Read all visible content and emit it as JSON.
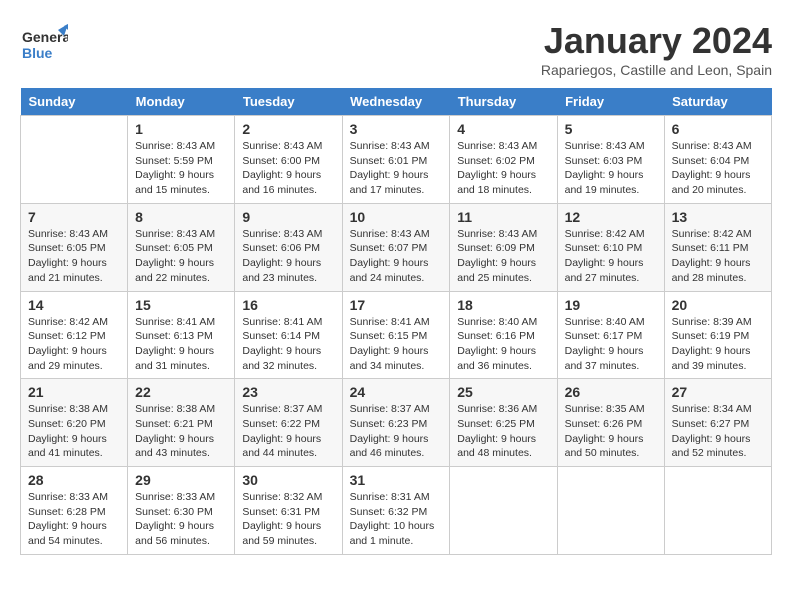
{
  "header": {
    "logo_general": "General",
    "logo_blue": "Blue",
    "month": "January 2024",
    "location": "Rapariegos, Castille and Leon, Spain"
  },
  "days_of_week": [
    "Sunday",
    "Monday",
    "Tuesday",
    "Wednesday",
    "Thursday",
    "Friday",
    "Saturday"
  ],
  "weeks": [
    [
      {
        "day": "",
        "info": ""
      },
      {
        "day": "1",
        "info": "Sunrise: 8:43 AM\nSunset: 5:59 PM\nDaylight: 9 hours\nand 15 minutes."
      },
      {
        "day": "2",
        "info": "Sunrise: 8:43 AM\nSunset: 6:00 PM\nDaylight: 9 hours\nand 16 minutes."
      },
      {
        "day": "3",
        "info": "Sunrise: 8:43 AM\nSunset: 6:01 PM\nDaylight: 9 hours\nand 17 minutes."
      },
      {
        "day": "4",
        "info": "Sunrise: 8:43 AM\nSunset: 6:02 PM\nDaylight: 9 hours\nand 18 minutes."
      },
      {
        "day": "5",
        "info": "Sunrise: 8:43 AM\nSunset: 6:03 PM\nDaylight: 9 hours\nand 19 minutes."
      },
      {
        "day": "6",
        "info": "Sunrise: 8:43 AM\nSunset: 6:04 PM\nDaylight: 9 hours\nand 20 minutes."
      }
    ],
    [
      {
        "day": "7",
        "info": "Sunrise: 8:43 AM\nSunset: 6:05 PM\nDaylight: 9 hours\nand 21 minutes."
      },
      {
        "day": "8",
        "info": "Sunrise: 8:43 AM\nSunset: 6:05 PM\nDaylight: 9 hours\nand 22 minutes."
      },
      {
        "day": "9",
        "info": "Sunrise: 8:43 AM\nSunset: 6:06 PM\nDaylight: 9 hours\nand 23 minutes."
      },
      {
        "day": "10",
        "info": "Sunrise: 8:43 AM\nSunset: 6:07 PM\nDaylight: 9 hours\nand 24 minutes."
      },
      {
        "day": "11",
        "info": "Sunrise: 8:43 AM\nSunset: 6:09 PM\nDaylight: 9 hours\nand 25 minutes."
      },
      {
        "day": "12",
        "info": "Sunrise: 8:42 AM\nSunset: 6:10 PM\nDaylight: 9 hours\nand 27 minutes."
      },
      {
        "day": "13",
        "info": "Sunrise: 8:42 AM\nSunset: 6:11 PM\nDaylight: 9 hours\nand 28 minutes."
      }
    ],
    [
      {
        "day": "14",
        "info": "Sunrise: 8:42 AM\nSunset: 6:12 PM\nDaylight: 9 hours\nand 29 minutes."
      },
      {
        "day": "15",
        "info": "Sunrise: 8:41 AM\nSunset: 6:13 PM\nDaylight: 9 hours\nand 31 minutes."
      },
      {
        "day": "16",
        "info": "Sunrise: 8:41 AM\nSunset: 6:14 PM\nDaylight: 9 hours\nand 32 minutes."
      },
      {
        "day": "17",
        "info": "Sunrise: 8:41 AM\nSunset: 6:15 PM\nDaylight: 9 hours\nand 34 minutes."
      },
      {
        "day": "18",
        "info": "Sunrise: 8:40 AM\nSunset: 6:16 PM\nDaylight: 9 hours\nand 36 minutes."
      },
      {
        "day": "19",
        "info": "Sunrise: 8:40 AM\nSunset: 6:17 PM\nDaylight: 9 hours\nand 37 minutes."
      },
      {
        "day": "20",
        "info": "Sunrise: 8:39 AM\nSunset: 6:19 PM\nDaylight: 9 hours\nand 39 minutes."
      }
    ],
    [
      {
        "day": "21",
        "info": "Sunrise: 8:38 AM\nSunset: 6:20 PM\nDaylight: 9 hours\nand 41 minutes."
      },
      {
        "day": "22",
        "info": "Sunrise: 8:38 AM\nSunset: 6:21 PM\nDaylight: 9 hours\nand 43 minutes."
      },
      {
        "day": "23",
        "info": "Sunrise: 8:37 AM\nSunset: 6:22 PM\nDaylight: 9 hours\nand 44 minutes."
      },
      {
        "day": "24",
        "info": "Sunrise: 8:37 AM\nSunset: 6:23 PM\nDaylight: 9 hours\nand 46 minutes."
      },
      {
        "day": "25",
        "info": "Sunrise: 8:36 AM\nSunset: 6:25 PM\nDaylight: 9 hours\nand 48 minutes."
      },
      {
        "day": "26",
        "info": "Sunrise: 8:35 AM\nSunset: 6:26 PM\nDaylight: 9 hours\nand 50 minutes."
      },
      {
        "day": "27",
        "info": "Sunrise: 8:34 AM\nSunset: 6:27 PM\nDaylight: 9 hours\nand 52 minutes."
      }
    ],
    [
      {
        "day": "28",
        "info": "Sunrise: 8:33 AM\nSunset: 6:28 PM\nDaylight: 9 hours\nand 54 minutes."
      },
      {
        "day": "29",
        "info": "Sunrise: 8:33 AM\nSunset: 6:30 PM\nDaylight: 9 hours\nand 56 minutes."
      },
      {
        "day": "30",
        "info": "Sunrise: 8:32 AM\nSunset: 6:31 PM\nDaylight: 9 hours\nand 59 minutes."
      },
      {
        "day": "31",
        "info": "Sunrise: 8:31 AM\nSunset: 6:32 PM\nDaylight: 10 hours\nand 1 minute."
      },
      {
        "day": "",
        "info": ""
      },
      {
        "day": "",
        "info": ""
      },
      {
        "day": "",
        "info": ""
      }
    ]
  ]
}
